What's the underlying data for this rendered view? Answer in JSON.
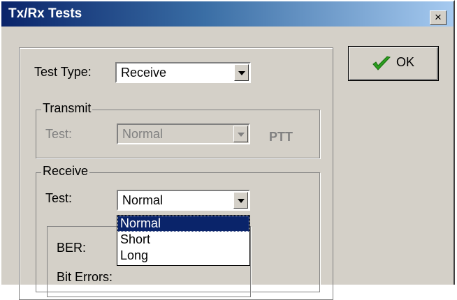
{
  "window": {
    "title": "Tx/Rx Tests",
    "close_label": "×"
  },
  "ok_button": {
    "label": "OK",
    "icon": "checkmark-icon",
    "check_color": "#2a9d1f"
  },
  "test_type": {
    "label": "Test Type:",
    "value": "Receive"
  },
  "transmit": {
    "group_title": "Transmit",
    "test_label": "Test:",
    "test_value": "Normal",
    "ptt_label": "PTT"
  },
  "receive": {
    "group_title": "Receive",
    "test_label": "Test:",
    "test_value": "Normal",
    "options": [
      "Normal",
      "Short",
      "Long"
    ],
    "selected_option": "Normal"
  },
  "stats": {
    "ber_label": "BER:",
    "bit_errors_label": "Bit Errors:"
  }
}
